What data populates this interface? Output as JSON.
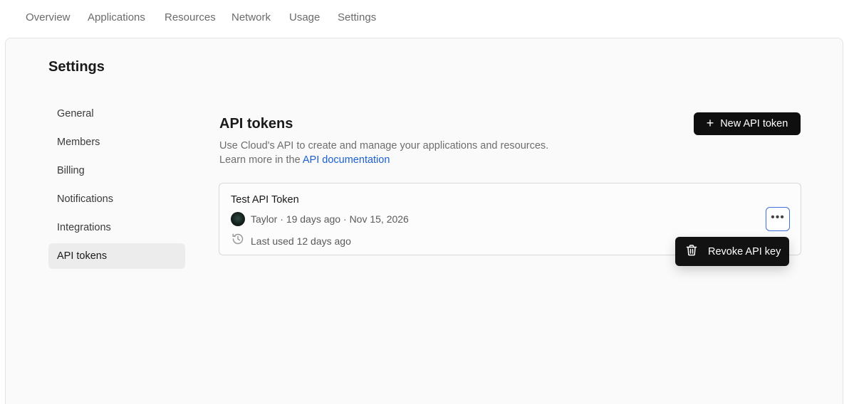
{
  "topnav": {
    "items": [
      "Overview",
      "Applications",
      "Resources",
      "Network",
      "Usage",
      "Settings"
    ]
  },
  "page": {
    "title": "Settings"
  },
  "sidebar": {
    "items": [
      {
        "label": "General"
      },
      {
        "label": "Members"
      },
      {
        "label": "Billing"
      },
      {
        "label": "Notifications"
      },
      {
        "label": "Integrations"
      },
      {
        "label": "API tokens",
        "active": true
      }
    ]
  },
  "section": {
    "title": "API tokens",
    "description_line1": "Use Cloud's API to create and manage your applications and resources.",
    "description_line2": "Learn more in the",
    "doc_link": "API documentation",
    "new_button_label": "New API token",
    "new_button_icon": "plus-icon"
  },
  "token": {
    "name": "Test API Token",
    "owner": "Taylor",
    "created": "19 days ago",
    "expires": "Nov 15, 2026",
    "separator": "·",
    "last_used": "Last used 12 days ago",
    "more_icon": "ellipsis-icon"
  },
  "menu": {
    "revoke_label": "Revoke API key",
    "revoke_icon": "trash-icon"
  },
  "colors": {
    "accent_link": "#1a5fd6",
    "focus_ring": "#3b6fd9",
    "button_dark": "#0f0f0f"
  }
}
